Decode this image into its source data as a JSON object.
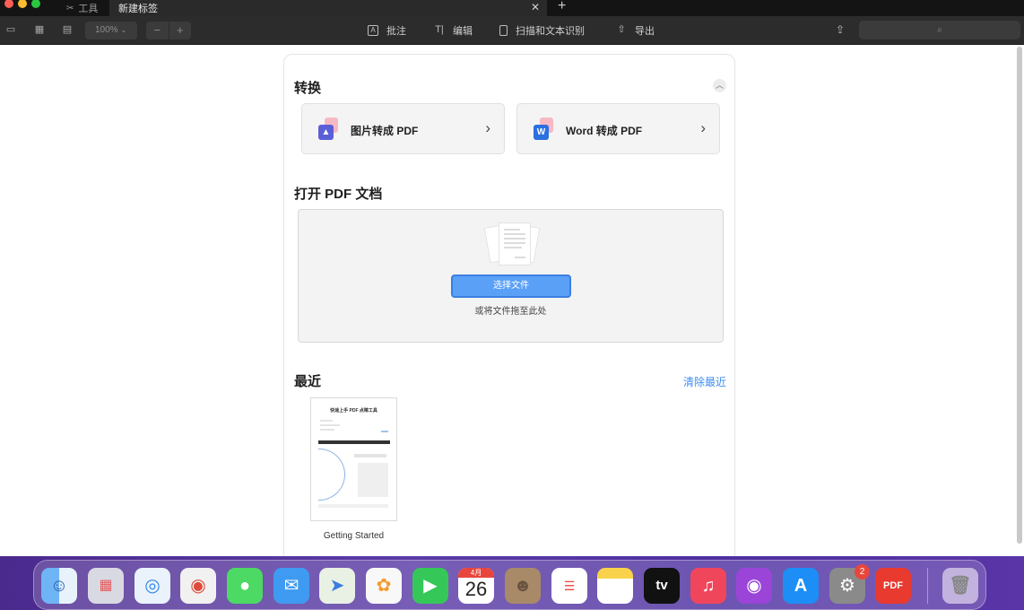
{
  "tabs": {
    "tools_label": "工具",
    "new_tab_label": "新建标签",
    "close_glyph": "✕",
    "add_glyph": "+"
  },
  "toolbar": {
    "zoom_value": "100%",
    "zoom_out": "−",
    "zoom_in": "+",
    "annotate_label": "批注",
    "edit_label": "编辑",
    "scan_ocr_label": "扫描和文本识别",
    "export_label": "导出"
  },
  "convert": {
    "heading": "转换",
    "cards": [
      {
        "label": "图片转成 PDF",
        "icon": "image-icon"
      },
      {
        "label": "Word 转成 PDF",
        "icon": "word-icon",
        "icon_letter": "W"
      }
    ]
  },
  "open_pdf": {
    "heading": "打开 PDF 文档",
    "choose_button": "选择文件",
    "drop_hint": "或将文件拖至此处"
  },
  "recent": {
    "heading": "最近",
    "clear_label": "清除最近",
    "files": [
      {
        "name": "Getting Started",
        "thumb_title": "快速上手 PDF 点睛工具"
      }
    ]
  },
  "dock": {
    "apps": [
      "finder",
      "launchpad",
      "safari",
      "chrome",
      "messages",
      "mail",
      "maps",
      "photos",
      "facetime",
      "calendar",
      "contacts",
      "reminders",
      "notes",
      "apple-tv",
      "music",
      "podcasts",
      "app-store",
      "system-settings",
      "pdf-app",
      "trash"
    ],
    "calendar_month": "4月",
    "calendar_day": "26",
    "settings_badge": "2",
    "tv_label": "tv",
    "pdf_label": "PDF"
  }
}
